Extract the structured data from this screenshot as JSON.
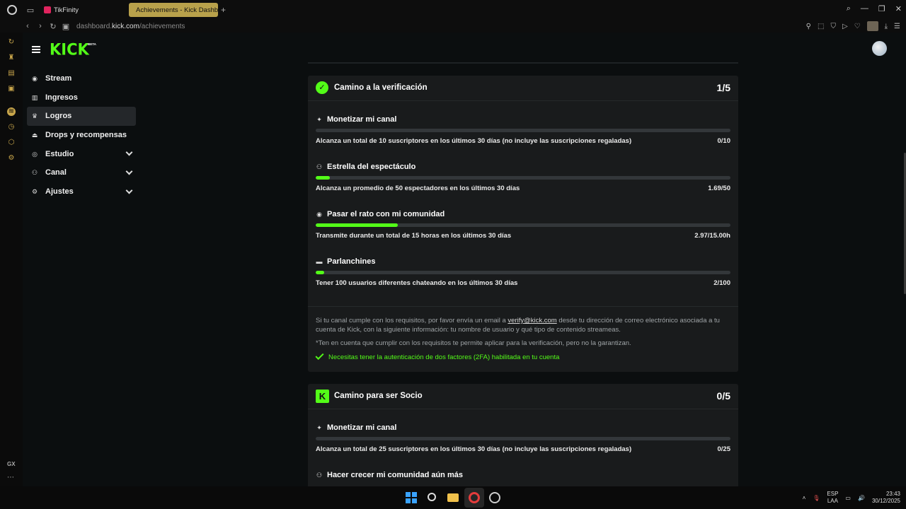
{
  "browser": {
    "tabs": [
      {
        "label": "TikFinity",
        "active": false
      },
      {
        "label": "Achievements - Kick Dashb",
        "active": true
      }
    ],
    "url_prefix": "dashboard.",
    "url_domain": "kick.com",
    "url_path": "/achievements"
  },
  "app": {
    "logo": "KICK",
    "logo_badge": "BETA",
    "nav": [
      {
        "label": "Stream",
        "icon": "stream-icon",
        "active": false,
        "expandable": false
      },
      {
        "label": "Ingresos",
        "icon": "chart-icon",
        "active": false,
        "expandable": false
      },
      {
        "label": "Logros",
        "icon": "trophy-icon",
        "active": true,
        "expandable": false
      },
      {
        "label": "Drops y recompensas",
        "icon": "drops-icon",
        "active": false,
        "expandable": false
      },
      {
        "label": "Estudio",
        "icon": "studio-icon",
        "active": false,
        "expandable": true
      },
      {
        "label": "Canal",
        "icon": "channel-icon",
        "active": false,
        "expandable": true
      },
      {
        "label": "Ajustes",
        "icon": "gear-icon",
        "active": false,
        "expandable": true
      }
    ]
  },
  "verification": {
    "title": "Camino a la verificación",
    "count": "1/5",
    "achievements": [
      {
        "title": "Monetizar mi canal",
        "icon": "sparkle-icon",
        "desc": "Alcanza un total de 10 suscriptores en los últimos 30 días (no incluye las suscripciones regaladas)",
        "value": "0/10",
        "progress": 0.0
      },
      {
        "title": "Estrella del espectáculo",
        "icon": "users-icon",
        "desc": "Alcanza un promedio de 50 espectadores en los últimos 30 días",
        "value": "1.69/50",
        "progress": 0.034
      },
      {
        "title": "Pasar el rato con mi comunidad",
        "icon": "broadcast-icon",
        "desc": "Transmite durante un total de 15 horas en los últimos 30 días",
        "value": "2.97/15.00h",
        "progress": 0.198
      },
      {
        "title": "Parlanchines",
        "icon": "chat-icon",
        "desc": "Tener 100 usuarios diferentes chateando en los últimos 30 días",
        "value": "2/100",
        "progress": 0.02
      }
    ],
    "info_before": "Si tu canal cumple con los requisitos, por favor envía un email a ",
    "info_email": "verify@kick.com",
    "info_after": " desde tu dirección de correo electrónico asociada a tu cuenta de Kick, con la siguiente información: tu nombre de usuario y qué tipo de contenido streameas.",
    "note": "*Ten en cuenta que cumplir con los requisitos te permite aplicar para la verificación, pero no la garantizan.",
    "twofa": "Necesitas tener la autenticación de dos factores (2FA) habilitada en tu cuenta"
  },
  "partner": {
    "title": "Camino para ser Socio",
    "count": "0/5",
    "achievements": [
      {
        "title": "Monetizar mi canal",
        "icon": "sparkle-icon",
        "desc": "Alcanza un total de 25 suscriptores en los últimos 30 días (no incluye las suscripciones regaladas)",
        "value": "0/25",
        "progress": 0.0
      },
      {
        "title": "Hacer crecer mi comunidad aún más",
        "icon": "users-icon",
        "desc": "",
        "value": "",
        "progress": 0.0
      }
    ]
  },
  "taskbar": {
    "lang_top": "ESP",
    "lang_bottom": "LAA",
    "time": "23:43",
    "date": "30/12/2025"
  },
  "colors": {
    "accent": "#53fc18",
    "card": "#191b1c",
    "background": "#0b0e0f"
  }
}
